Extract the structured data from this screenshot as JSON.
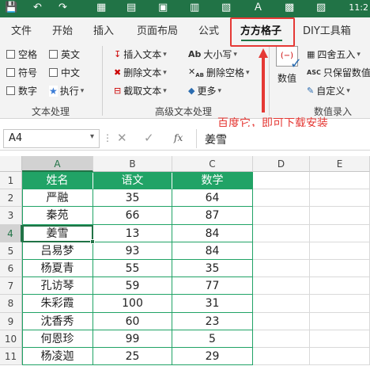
{
  "titlebar": {
    "save_icon": "save-icon",
    "undo_icon": "undo-icon",
    "redo_icon": "redo-icon",
    "file_time": "11:2"
  },
  "tabs": [
    "文件",
    "开始",
    "插入",
    "页面布局",
    "公式",
    "方方格子",
    "DIY工具箱"
  ],
  "active_tab": "方方格子",
  "ribbon": {
    "text_group": {
      "label": "文本处理",
      "checks": [
        "空格",
        "英文",
        "符号",
        "中文",
        "数字"
      ],
      "execute": "执行"
    },
    "adv_group": {
      "label": "高级文本处理",
      "col1": [
        "插入文本",
        "删除文本",
        "截取文本"
      ],
      "col2": [
        "大小写",
        "删除空格",
        "更多"
      ]
    },
    "num_group": {
      "label": "数值录入",
      "big_button": "数值",
      "items": [
        "四舍五入",
        "只保留数值",
        "自定义"
      ]
    }
  },
  "annotation": "百度它，即可下载安装",
  "formula_bar": {
    "name_box": "A4",
    "fx": "fx",
    "value": "姜雪"
  },
  "columns": [
    "A",
    "B",
    "C",
    "D",
    "E"
  ],
  "rows": [
    "1",
    "2",
    "3",
    "4",
    "5",
    "6",
    "7",
    "8",
    "9",
    "10",
    "11"
  ],
  "table": {
    "headers": [
      "姓名",
      "语文",
      "数学"
    ],
    "data": [
      [
        "严融",
        "35",
        "64"
      ],
      [
        "秦苑",
        "66",
        "87"
      ],
      [
        "姜雪",
        "13",
        "84"
      ],
      [
        "吕易梦",
        "93",
        "84"
      ],
      [
        "杨夏青",
        "55",
        "35"
      ],
      [
        "孔访琴",
        "59",
        "77"
      ],
      [
        "朱彩霞",
        "100",
        "31"
      ],
      [
        "沈香秀",
        "60",
        "23"
      ],
      [
        "何恩珍",
        "99",
        "5"
      ],
      [
        "杨凌迦",
        "25",
        "29"
      ]
    ]
  },
  "selected_cell": "A4",
  "colors": {
    "excel_green": "#217346",
    "table_header": "#21a366",
    "highlight_red": "#e53935"
  }
}
